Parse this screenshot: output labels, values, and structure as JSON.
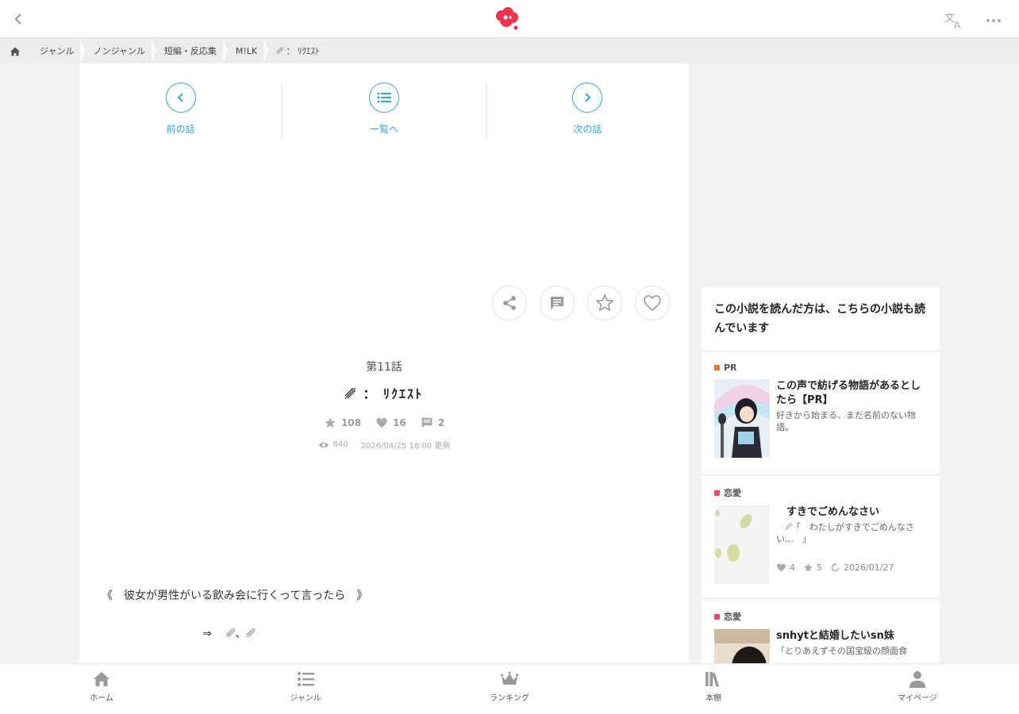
{
  "breadcrumb": [
    "ジャンル",
    "ノンジャンル",
    "短編・反応集",
    "M!LK",
    "␥ ： ﾘｸｴｽﾄ"
  ],
  "episode_nav": {
    "prev": "前の話",
    "list": "一覧へ",
    "next": "次の話"
  },
  "episode": {
    "number": "第11話",
    "title": "␥ ： ﾘｸｴｽﾄ",
    "stars": "108",
    "likes": "16",
    "comments": "2",
    "views": "840",
    "updated": "2026/04/25 18:00 更新"
  },
  "body": {
    "line1": "《　彼女が男性がいる飲み会に行くって言ったら　》",
    "line2": "⇒　 ␥、␥"
  },
  "side": {
    "heading": "この小説を読んだ方は、こちらの小説も読んでいます",
    "recs": [
      {
        "tag": "PR",
        "tag_color": "#e8743b",
        "title": "この声で紡げる物語があるとしたら【PR】",
        "desc": "好きから始まる、まだ名前のない物語。"
      },
      {
        "tag": "恋愛",
        "tag_color": "#e84a6a",
        "title": "　すきでごめんなさい",
        "desc": "　␥「　わたしがすきでごめんなさい…　」",
        "likes": "4",
        "stars": "5",
        "date": "2026/01/27"
      },
      {
        "tag": "恋愛",
        "tag_color": "#e84a6a",
        "title": "snhytと結婚したいsn妹",
        "desc": "「とりあえずその国宝級の顔面食"
      }
    ]
  },
  "bottom_nav": [
    "ホーム",
    "ジャンル",
    "ランキング",
    "本棚",
    "マイページ"
  ],
  "colors": {
    "accent": "#36a3d9",
    "logo": "#f0344f"
  }
}
